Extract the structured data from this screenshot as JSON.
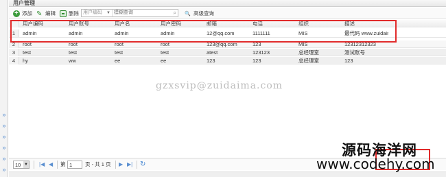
{
  "panel": {
    "title": "用户管理"
  },
  "toolbar": {
    "add_label": "添加",
    "edit_label": "编辑",
    "delete_label": "删除",
    "search_field_selected": "用户编码",
    "search_placeholder": "模糊查询",
    "advanced_search_label": "高级查询"
  },
  "grid": {
    "columns": [
      "用户编码",
      "用户账号",
      "用户名",
      "用户密码",
      "邮箱",
      "电话",
      "组织",
      "描述"
    ],
    "rows": [
      {
        "num": "1",
        "cells": [
          "admin",
          "admin",
          "admin",
          "admin",
          "12@qq.com",
          "1111111",
          "MIS",
          "最代码 www.zuidaim"
        ]
      },
      {
        "num": "2",
        "cells": [
          "root",
          "root",
          "root",
          "root",
          "123@qq.com",
          "123",
          "MIS",
          "12312312323"
        ]
      },
      {
        "num": "3",
        "cells": [
          "test",
          "test",
          "test",
          "test",
          "atest",
          "123123",
          "总经理室",
          "测试账号"
        ]
      },
      {
        "num": "4",
        "cells": [
          "hy",
          "ww",
          "ee",
          "ee",
          "123",
          "123",
          "总经理室",
          "123"
        ]
      }
    ]
  },
  "watermark": "gzxsvip@zuidaima.com",
  "pager": {
    "page_size": "10",
    "page_prefix": "第",
    "page_value": "1",
    "page_suffix": "页 - 共 1 页"
  },
  "branding": {
    "site_name": "源码海洋网",
    "site_url": "www.codehy.com"
  },
  "colors": {
    "highlight_border": "#e12b2b",
    "accent_green": "#3a9b3a",
    "nav_blue": "#5b8fd0"
  }
}
